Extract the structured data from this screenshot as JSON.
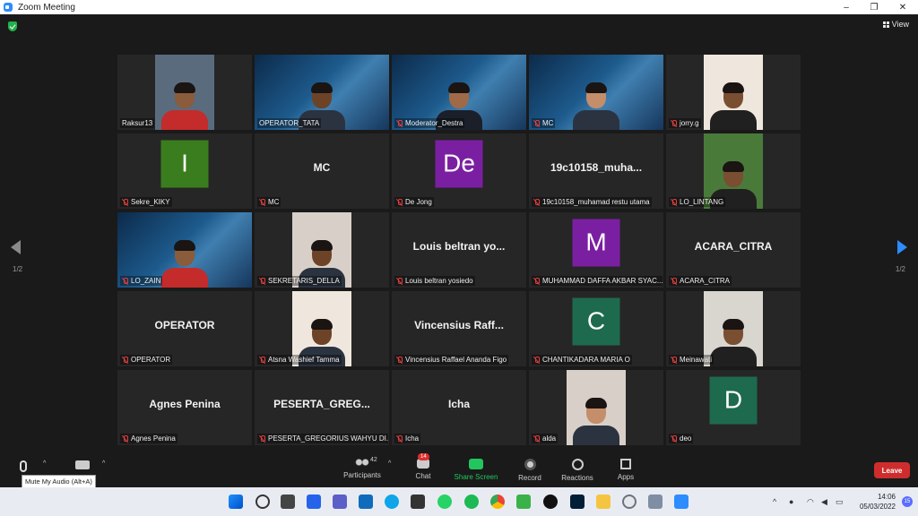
{
  "window": {
    "title": "Zoom Meeting",
    "minimize": "–",
    "restore": "❐",
    "close": "✕"
  },
  "meeting": {
    "view_label": "View",
    "page_left": "1/2",
    "page_right": "1/2"
  },
  "participants": [
    {
      "name": "Raksur13",
      "type": "video",
      "muted": false
    },
    {
      "name": "OPERATOR_TATA",
      "type": "webinar",
      "muted": false,
      "active": true
    },
    {
      "name": "Moderator_Destra",
      "type": "webinar",
      "muted": true
    },
    {
      "name": "MC",
      "type": "webinar",
      "muted": true
    },
    {
      "name": "jorry.g",
      "type": "video",
      "muted": true
    },
    {
      "name": "Sekre_KIKY",
      "type": "avatar",
      "initial": "I",
      "color": "#3a7d1e",
      "muted": true
    },
    {
      "name": "MC",
      "type": "text",
      "display": "MC",
      "muted": true
    },
    {
      "name": "De Jong",
      "type": "avatar",
      "initial": "De",
      "color": "#7b1fa2",
      "muted": true
    },
    {
      "name": "19c10158_muhamad restu utama",
      "type": "text",
      "display": "19c10158_muha...",
      "muted": true
    },
    {
      "name": "LO_LINTANG",
      "type": "video",
      "muted": true
    },
    {
      "name": "LO_ZAIN",
      "type": "webinar",
      "muted": true
    },
    {
      "name": "SEKRETARIS_DELLA",
      "type": "video",
      "muted": true
    },
    {
      "name": "Louis beltran yosiedo",
      "type": "text",
      "display": "Louis beltran yo...",
      "muted": true
    },
    {
      "name": "MUHAMMAD DAFFA AKBAR SYAC...",
      "type": "avatar",
      "initial": "M",
      "color": "#7b1fa2",
      "muted": true
    },
    {
      "name": "ACARA_CITRA",
      "type": "text",
      "display": "ACARA_CITRA",
      "muted": true
    },
    {
      "name": "OPERATOR",
      "type": "text",
      "display": "OPERATOR",
      "muted": true
    },
    {
      "name": "Atsna Washief Tamma",
      "type": "video",
      "muted": true
    },
    {
      "name": "Vincensius Raffael Ananda Figo",
      "type": "text",
      "display": "Vincensius Raff...",
      "muted": true
    },
    {
      "name": "CHANTIKADARA MARIA O",
      "type": "avatar",
      "initial": "C",
      "color": "#1e6a4e",
      "muted": true
    },
    {
      "name": "Meinawati",
      "type": "video",
      "muted": true
    },
    {
      "name": "Agnes Penina",
      "type": "text",
      "display": "Agnes Penina",
      "muted": true
    },
    {
      "name": "PESERTA_GREGORIUS WAHYU DI...",
      "type": "text",
      "display": "PESERTA_GREG...",
      "muted": true
    },
    {
      "name": "Icha",
      "type": "text",
      "display": "Icha",
      "muted": true
    },
    {
      "name": "alda",
      "type": "video",
      "muted": true
    },
    {
      "name": "deo",
      "type": "avatar",
      "initial": "D",
      "color": "#1e6a4e",
      "muted": true
    }
  ],
  "toolbar": {
    "participants_label": "Participants",
    "participants_count": "42",
    "chat_label": "Chat",
    "chat_badge": "14",
    "share_label": "Share Screen",
    "record_label": "Record",
    "reactions_label": "Reactions",
    "apps_label": "Apps",
    "leave_label": "Leave",
    "tooltip": "Mute My Audio (Alt+A)"
  },
  "taskbar": {
    "time": "14:06",
    "date": "05/03/2022",
    "notifications": "15"
  }
}
